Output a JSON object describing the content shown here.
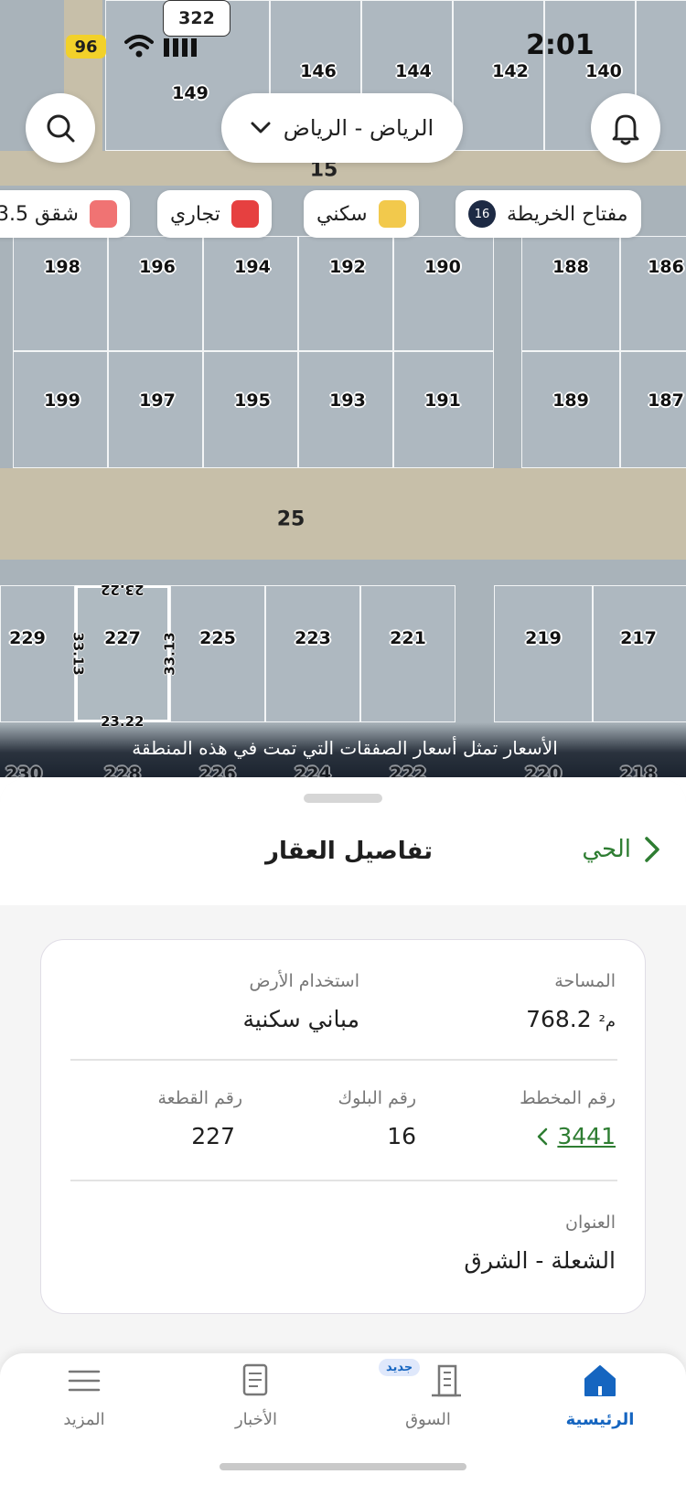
{
  "status_bar": {
    "notification_count": "322",
    "battery": "96",
    "time": "2:01"
  },
  "header": {
    "city_selector": "الرياض - الرياض",
    "search_icon": "search-icon",
    "bell_icon": "bell-icon",
    "chevron_icon": "chevron-down-icon"
  },
  "legend": {
    "map_key_label": "مفتاح الخريطة",
    "map_key_count": "16",
    "items": [
      {
        "label": "سكني",
        "color": "#f2c94c"
      },
      {
        "label": "تجاري",
        "color": "#e64040"
      },
      {
        "label": "شقق 3.5",
        "color": "#f07373"
      }
    ]
  },
  "map": {
    "roads": [
      "15",
      "25"
    ],
    "top_plots": [
      "149",
      "146",
      "144",
      "142",
      "140"
    ],
    "row1_plots": [
      "198",
      "196",
      "194",
      "192",
      "190",
      "188",
      "186"
    ],
    "row2_plots": [
      "199",
      "197",
      "195",
      "193",
      "191",
      "189",
      "187"
    ],
    "row3_plots": [
      "229",
      "227",
      "225",
      "223",
      "221",
      "219",
      "217"
    ],
    "row4_plots": [
      "230",
      "228",
      "226",
      "224",
      "222",
      "220",
      "218"
    ],
    "dimensions": {
      "top": "23.22",
      "bottom": "23.22",
      "left": "33.13",
      "right": "33.13"
    },
    "note": "الأسعار تمثل أسعار الصفقات التي تمت في هذه المنطقة"
  },
  "sheet": {
    "title": "تفاصيل العقار",
    "district_link": "الحي",
    "area_label": "المساحة",
    "area_value": "768.2",
    "area_unit": "م²",
    "land_use_label": "استخدام الأرض",
    "land_use_value": "مباني سكنية",
    "plan_label": "رقم المخطط",
    "plan_value": "3441",
    "block_label": "رقم البلوك",
    "block_value": "16",
    "plot_label": "رقم القطعة",
    "plot_value": "227",
    "address_label": "العنوان",
    "address_value": "الشعلة - الشرق"
  },
  "nav": {
    "home": "الرئيسية",
    "market": "السوق",
    "market_badge": "جديد",
    "news": "الأخبار",
    "more": "المزيد",
    "active_color": "#1565c0"
  }
}
